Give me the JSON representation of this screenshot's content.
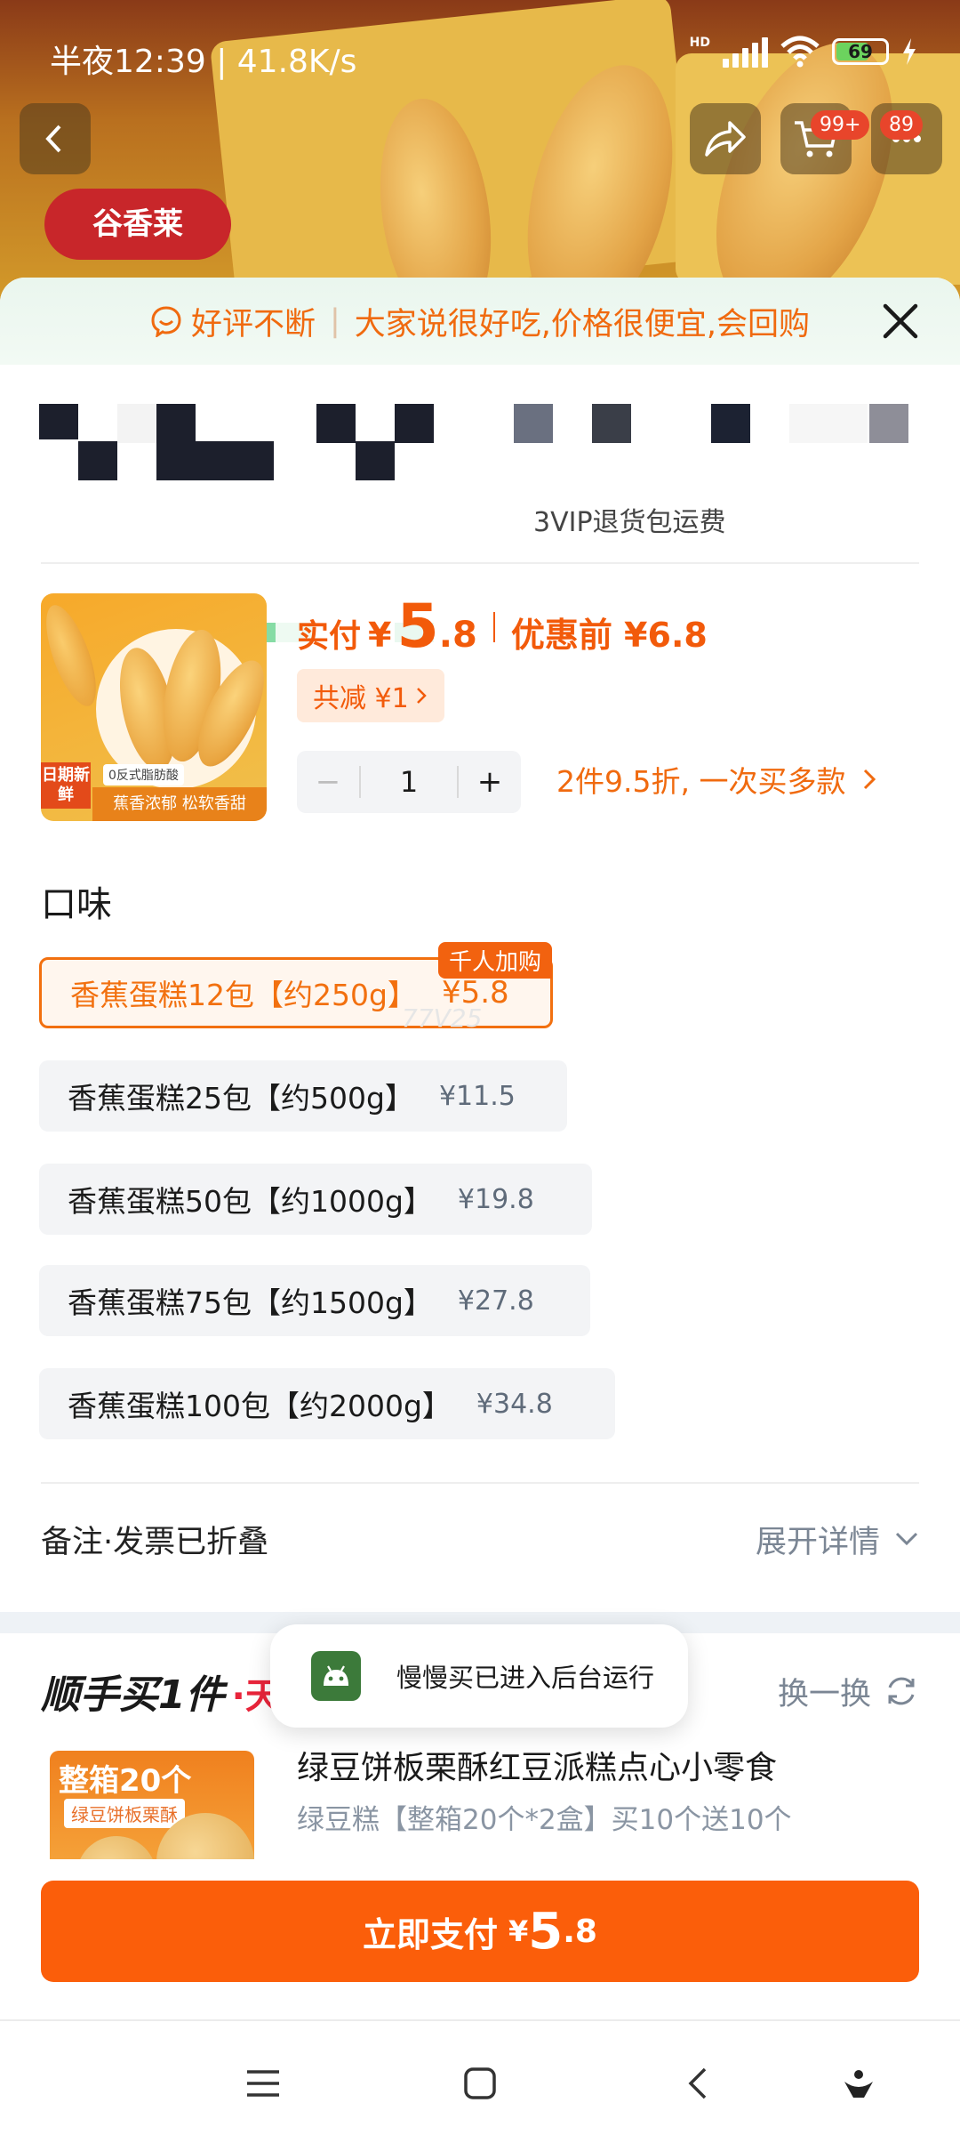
{
  "status_bar": {
    "time": "半夜12:39 | 41.8K/s",
    "network": "HD",
    "battery": "69"
  },
  "header_overlay": {
    "brand_text": "谷香莱",
    "cart_badge": "99+",
    "message_badge": "89"
  },
  "promo": {
    "highlight": "好评不断",
    "text": "大家说很好吃,价格很便宜,会回购"
  },
  "obscured_line_text": "3VIP退货包运费",
  "product": {
    "thumb_badge_left": "日期新鲜",
    "thumb_banner": "蕉香浓郁 松软香甜",
    "thumb_tag": "0反式脂肪酸",
    "pay_label": "实付",
    "currency": "¥",
    "price_int": "5",
    "price_dec": ".8",
    "before_label": "优惠前 ¥6.8",
    "discount_chip": "共减 ¥1",
    "quantity": "1",
    "qty_minus": "−",
    "qty_plus": "+",
    "bulk_offer": "2件9.5折, 一次买多款"
  },
  "flavor": {
    "title": "口味",
    "hot_badge": "千人加购",
    "options": [
      {
        "label": "香蕉蛋糕12包【约250g】",
        "price": "¥5.8",
        "selected": true
      },
      {
        "label": "香蕉蛋糕25包【约500g】",
        "price": "¥11.5",
        "selected": false
      },
      {
        "label": "香蕉蛋糕50包【约1000g】",
        "price": "¥19.8",
        "selected": false
      },
      {
        "label": "香蕉蛋糕75包【约1500g】",
        "price": "¥27.8",
        "selected": false
      },
      {
        "label": "香蕉蛋糕100包【约2000g】",
        "price": "¥34.8",
        "selected": false
      }
    ],
    "watermark": "77V25"
  },
  "notes": {
    "label": "备注·发票已折叠",
    "expand": "展开详情"
  },
  "recommend": {
    "brand": "顺手买1件",
    "brand_tail": "·天",
    "swap": "换一换",
    "image_title": "整箱20个",
    "image_sub": "绿豆饼板栗酥",
    "name": "绿豆饼板栗酥红豆派糕点心小零食",
    "spec": "绿豆糕【整箱20个*2盒】买10个送10个"
  },
  "toast": {
    "text": "慢慢买已进入后台运行"
  },
  "pay_button": {
    "label": "立即支付",
    "currency": "¥",
    "price_int": "5",
    "price_dec": ".8"
  },
  "colors": {
    "accent": "#fb5e0a",
    "promo_text": "#f06a0f",
    "selected_border": "#f2700f"
  }
}
